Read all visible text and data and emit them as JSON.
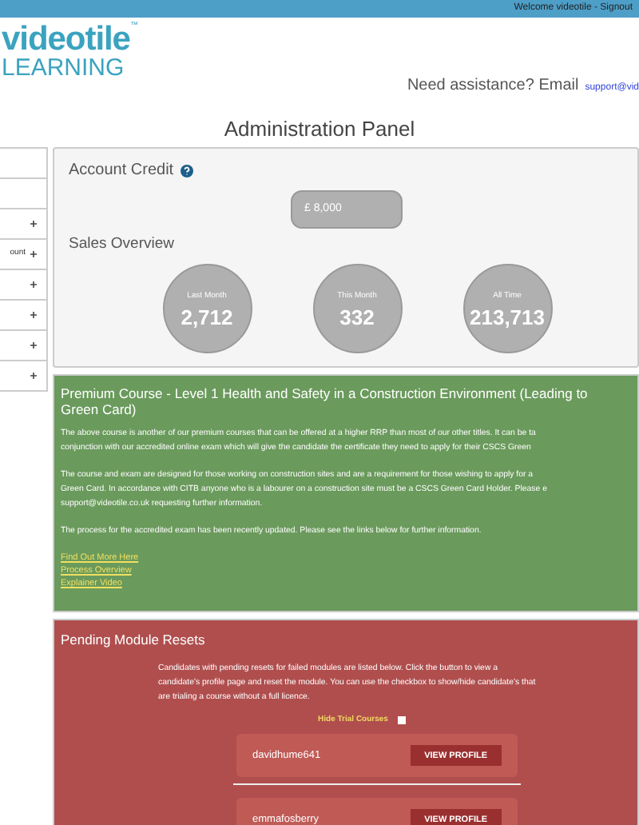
{
  "top_bar": {
    "welcome": "Welcome videotile - Signout"
  },
  "logo": {
    "line1": "videotile",
    "line2": "LEARNING",
    "mark": "™"
  },
  "assistance": {
    "text": "Need assistance? Email",
    "link": "support@vid"
  },
  "page_title": "Administration Panel",
  "sidebar": {
    "items": [
      {
        "expandable": false
      },
      {
        "expandable": false
      },
      {
        "expandable": true
      },
      {
        "expandable": true,
        "label": "ount"
      },
      {
        "expandable": true
      },
      {
        "expandable": true
      },
      {
        "expandable": true
      },
      {
        "expandable": true
      }
    ]
  },
  "account": {
    "heading": "Account Credit",
    "credit": "£ 8,000",
    "sales_heading": "Sales Overview",
    "stats": [
      {
        "label": "Last Month",
        "value": "2,712"
      },
      {
        "label": "This Month",
        "value": "332"
      },
      {
        "label": "All Time",
        "value": "213,713"
      }
    ]
  },
  "premium": {
    "title_lines": [
      "Premium Course - Level 1 Health and Safety in a Construction Environment (Leading to",
      "Green Card)"
    ],
    "paragraphs": [
      [
        "The above course is another of our premium courses that can be offered at a higher RRP than most of our other titles. It can be ta",
        "conjunction with our accredited online exam which will give the candidate the certificate they need to apply for their CSCS Green"
      ],
      [
        "The course and exam are designed for those working on construction sites and are a requirement for those wishing to apply for a",
        "Green Card. In accordance with CITB anyone who is a labourer on a construction site must be a CSCS Green Card Holder. Please e",
        "support@videotile.co.uk requesting further information."
      ],
      [
        "The process for the accredited exam has been recently updated. Please see the links below for further information."
      ]
    ],
    "links": [
      "Find Out More Here",
      "Process Overview",
      "Explainer Video"
    ]
  },
  "resets": {
    "title": "Pending Module Resets",
    "intro_lines": [
      "Candidates with pending resets for failed modules are listed below. Click the button to view a",
      "candidate's profile page and reset the module. You can use the checkbox to show/hide candidate's that",
      "are trialing a course without a full licence."
    ],
    "hide_trial": {
      "label": "Hide Trial Courses",
      "checked": false
    },
    "candidates": [
      {
        "name": "davidhume641",
        "button": "VIEW PROFILE"
      },
      {
        "name": "emmafosberry",
        "button": "VIEW PROFILE"
      }
    ]
  }
}
